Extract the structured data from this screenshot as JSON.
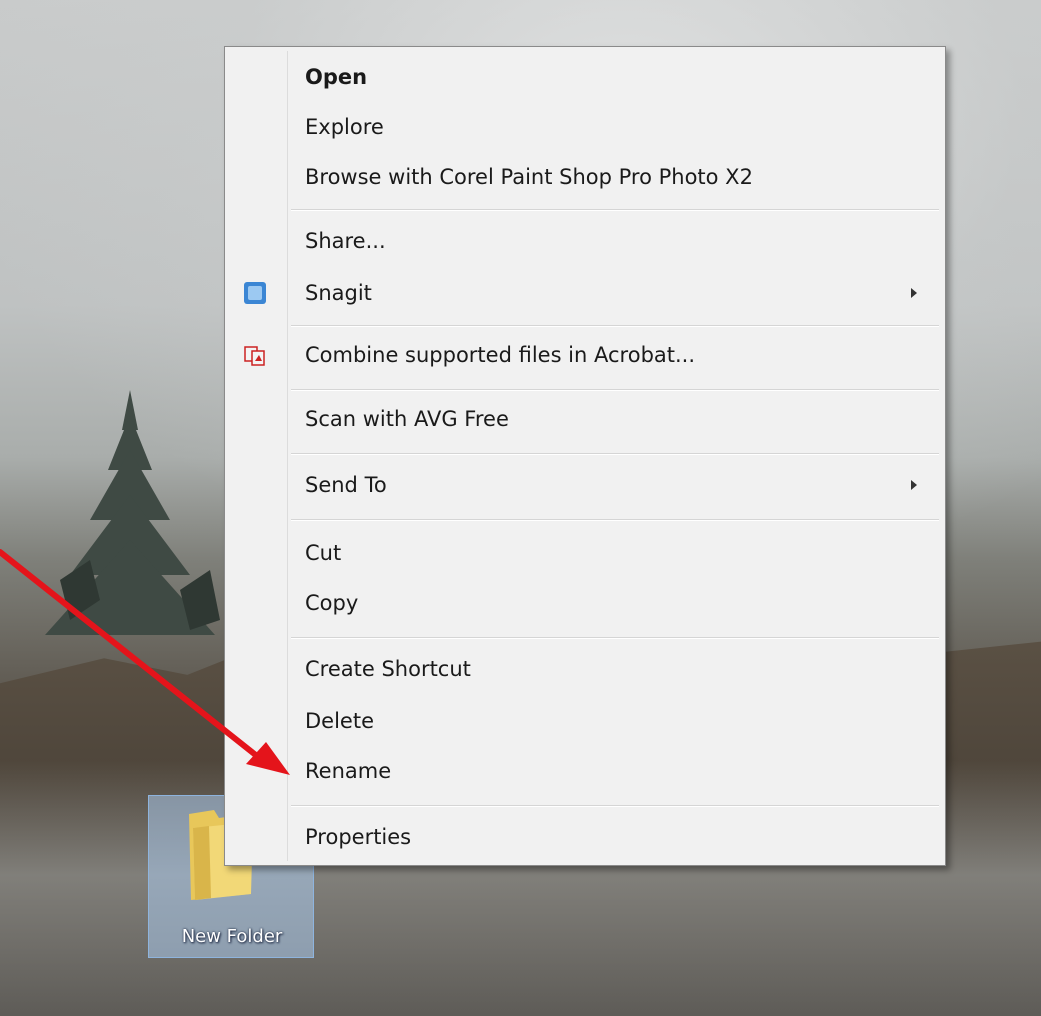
{
  "desktop": {
    "folder_label": "New Folder"
  },
  "context_menu": {
    "items": [
      {
        "label": "Open",
        "bold": true
      },
      {
        "label": "Explore"
      },
      {
        "label": "Browse with Corel Paint Shop Pro Photo X2"
      },
      {
        "label": "Share..."
      },
      {
        "label": "Snagit",
        "icon": "snagit-icon",
        "submenu": true
      },
      {
        "label": "Combine supported files in Acrobat...",
        "icon": "acrobat-icon"
      },
      {
        "label": "Scan with AVG Free"
      },
      {
        "label": "Send To",
        "submenu": true
      },
      {
        "label": "Cut"
      },
      {
        "label": "Copy"
      },
      {
        "label": "Create Shortcut"
      },
      {
        "label": "Delete"
      },
      {
        "label": "Rename"
      },
      {
        "label": "Properties"
      }
    ]
  },
  "annotation": {
    "arrow_color": "#e4141b",
    "arrow_points_to": "Rename"
  },
  "colors": {
    "menu_background": "#f1f1f1",
    "selection_blue": "#aac8eb"
  }
}
